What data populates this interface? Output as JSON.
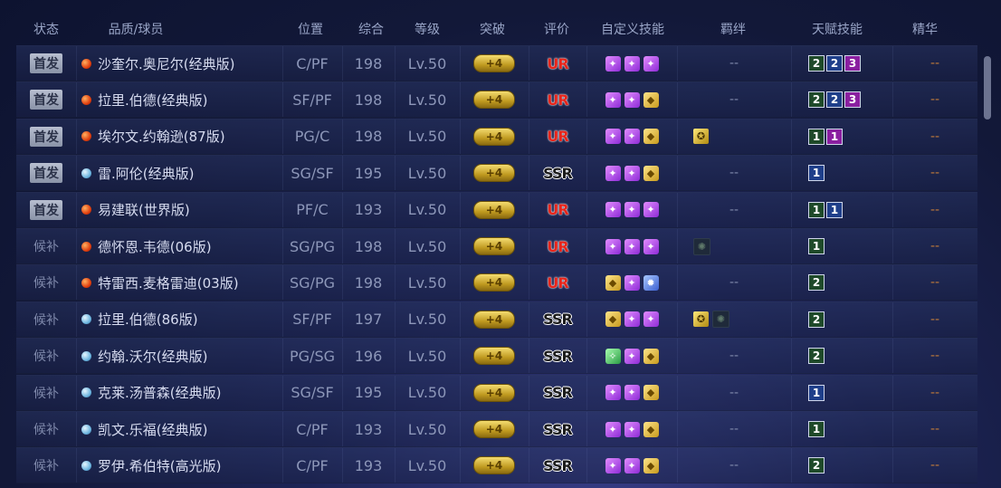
{
  "headers": {
    "status": "状态",
    "player": "品质/球员",
    "position": "位置",
    "overall": "综合",
    "level": "等级",
    "breakthrough": "突破",
    "rating": "评价",
    "custom_skills": "自定义技能",
    "bond": "羁绊",
    "talent": "天赋技能",
    "essence": "精华"
  },
  "rows": [
    {
      "status": "首发",
      "status_type": "start",
      "dot": "red",
      "name": "沙奎尔.奥尼尔(经典版)",
      "position": "C/PF",
      "overall": "198",
      "level": "Lv.50",
      "breakthrough": "+4",
      "rating": "UR",
      "skills": [
        "purple",
        "purple",
        "purple"
      ],
      "bond": "--",
      "bonds": [],
      "talents": [
        {
          "v": "2",
          "c": "green"
        },
        {
          "v": "2",
          "c": "blue"
        },
        {
          "v": "3",
          "c": "purple"
        }
      ],
      "essence": "--"
    },
    {
      "status": "首发",
      "status_type": "start",
      "dot": "red",
      "name": "拉里.伯德(经典版)",
      "position": "SF/PF",
      "overall": "198",
      "level": "Lv.50",
      "breakthrough": "+4",
      "rating": "UR",
      "skills": [
        "purple",
        "purple",
        "gold"
      ],
      "bond": "--",
      "bonds": [],
      "talents": [
        {
          "v": "2",
          "c": "green"
        },
        {
          "v": "2",
          "c": "blue"
        },
        {
          "v": "3",
          "c": "purple"
        }
      ],
      "essence": "--"
    },
    {
      "status": "首发",
      "status_type": "start",
      "dot": "red",
      "name": "埃尔文.约翰逊(87版)",
      "position": "PG/C",
      "overall": "198",
      "level": "Lv.50",
      "breakthrough": "+4",
      "rating": "UR",
      "skills": [
        "purple",
        "purple",
        "gold"
      ],
      "bond": "",
      "bonds": [
        "gold"
      ],
      "talents": [
        {
          "v": "1",
          "c": "green"
        },
        {
          "v": "1",
          "c": "purple"
        }
      ],
      "essence": "--"
    },
    {
      "status": "首发",
      "status_type": "start",
      "dot": "blue",
      "name": "雷.阿伦(经典版)",
      "position": "SG/SF",
      "overall": "195",
      "level": "Lv.50",
      "breakthrough": "+4",
      "rating": "SSR",
      "skills": [
        "purple",
        "purple",
        "gold"
      ],
      "bond": "--",
      "bonds": [],
      "talents": [
        {
          "v": "1",
          "c": "blue"
        }
      ],
      "essence": "--"
    },
    {
      "status": "首发",
      "status_type": "start",
      "dot": "red",
      "name": "易建联(世界版)",
      "position": "PF/C",
      "overall": "193",
      "level": "Lv.50",
      "breakthrough": "+4",
      "rating": "UR",
      "skills": [
        "purple",
        "purple",
        "purple"
      ],
      "bond": "--",
      "bonds": [],
      "talents": [
        {
          "v": "1",
          "c": "green"
        },
        {
          "v": "1",
          "c": "blue"
        }
      ],
      "essence": "--"
    },
    {
      "status": "候补",
      "status_type": "sub",
      "dot": "red",
      "name": "德怀恩.韦德(06版)",
      "position": "SG/PG",
      "overall": "198",
      "level": "Lv.50",
      "breakthrough": "+4",
      "rating": "UR",
      "skills": [
        "purple",
        "purple",
        "purple"
      ],
      "bond": "",
      "bonds": [
        "dark"
      ],
      "talents": [
        {
          "v": "1",
          "c": "green"
        }
      ],
      "essence": "--"
    },
    {
      "status": "候补",
      "status_type": "sub",
      "dot": "red",
      "name": "特雷西.麦格雷迪(03版)",
      "position": "SG/PG",
      "overall": "198",
      "level": "Lv.50",
      "breakthrough": "+4",
      "rating": "UR",
      "skills": [
        "gold",
        "purple",
        "blue"
      ],
      "bond": "--",
      "bonds": [],
      "talents": [
        {
          "v": "2",
          "c": "green"
        }
      ],
      "essence": "--"
    },
    {
      "status": "候补",
      "status_type": "sub",
      "dot": "blue",
      "name": "拉里.伯德(86版)",
      "position": "SF/PF",
      "overall": "197",
      "level": "Lv.50",
      "breakthrough": "+4",
      "rating": "SSR",
      "skills": [
        "gold",
        "purple",
        "purple"
      ],
      "bond": "",
      "bonds": [
        "gold",
        "dark"
      ],
      "talents": [
        {
          "v": "2",
          "c": "green"
        }
      ],
      "essence": "--"
    },
    {
      "status": "候补",
      "status_type": "sub",
      "dot": "blue",
      "name": "约翰.沃尔(经典版)",
      "position": "PG/SG",
      "overall": "196",
      "level": "Lv.50",
      "breakthrough": "+4",
      "rating": "SSR",
      "skills": [
        "green",
        "purple",
        "gold"
      ],
      "bond": "--",
      "bonds": [],
      "talents": [
        {
          "v": "2",
          "c": "green"
        }
      ],
      "essence": "--"
    },
    {
      "status": "候补",
      "status_type": "sub",
      "dot": "blue",
      "name": "克莱.汤普森(经典版)",
      "position": "SG/SF",
      "overall": "195",
      "level": "Lv.50",
      "breakthrough": "+4",
      "rating": "SSR",
      "skills": [
        "purple",
        "purple",
        "gold"
      ],
      "bond": "--",
      "bonds": [],
      "talents": [
        {
          "v": "1",
          "c": "blue"
        }
      ],
      "essence": "--"
    },
    {
      "status": "候补",
      "status_type": "sub",
      "dot": "blue",
      "name": "凯文.乐福(经典版)",
      "position": "C/PF",
      "overall": "193",
      "level": "Lv.50",
      "breakthrough": "+4",
      "rating": "SSR",
      "skills": [
        "purple",
        "purple",
        "gold"
      ],
      "bond": "--",
      "bonds": [],
      "talents": [
        {
          "v": "1",
          "c": "green"
        }
      ],
      "essence": "--"
    },
    {
      "status": "候补",
      "status_type": "sub",
      "dot": "blue",
      "name": "罗伊.希伯特(高光版)",
      "position": "C/PF",
      "overall": "193",
      "level": "Lv.50",
      "breakthrough": "+4",
      "rating": "SSR",
      "skills": [
        "purple",
        "purple",
        "gold"
      ],
      "bond": "--",
      "bonds": [],
      "talents": [
        {
          "v": "2",
          "c": "green"
        }
      ],
      "essence": "--"
    }
  ]
}
